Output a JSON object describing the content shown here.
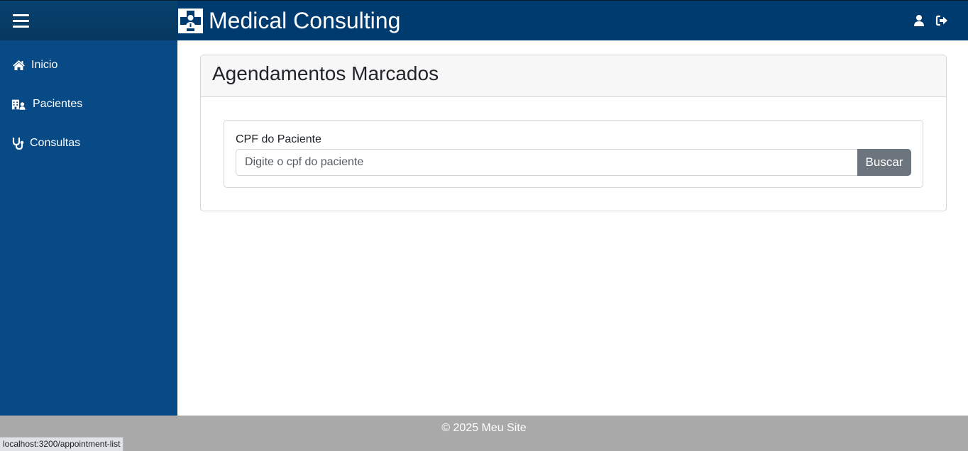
{
  "header": {
    "title": "Medical Consulting",
    "menu_icon": "hamburger-menu-icon",
    "logo_icon": "medical-doctor-cross-logo",
    "user_icon": "user-icon",
    "logout_icon": "sign-out-icon"
  },
  "sidebar": {
    "items": [
      {
        "label": "Inicio",
        "icon": "home-icon"
      },
      {
        "label": "Pacientes",
        "icon": "hospital-user-icon"
      },
      {
        "label": "Consultas",
        "icon": "stethoscope-icon"
      }
    ]
  },
  "main": {
    "card_title": "Agendamentos Marcados",
    "cpf_label": "CPF do Paciente",
    "cpf_placeholder": "Digite o cpf do paciente",
    "cpf_value": "",
    "search_button": "Buscar"
  },
  "footer": {
    "text": "© 2025 Meu Site"
  },
  "status_bar": {
    "url": "localhost:3200/appointment-list"
  },
  "colors": {
    "topbar": "#003b70",
    "sidebar": "#074a86",
    "footer": "#a9a9a9",
    "button": "#6c757d"
  }
}
